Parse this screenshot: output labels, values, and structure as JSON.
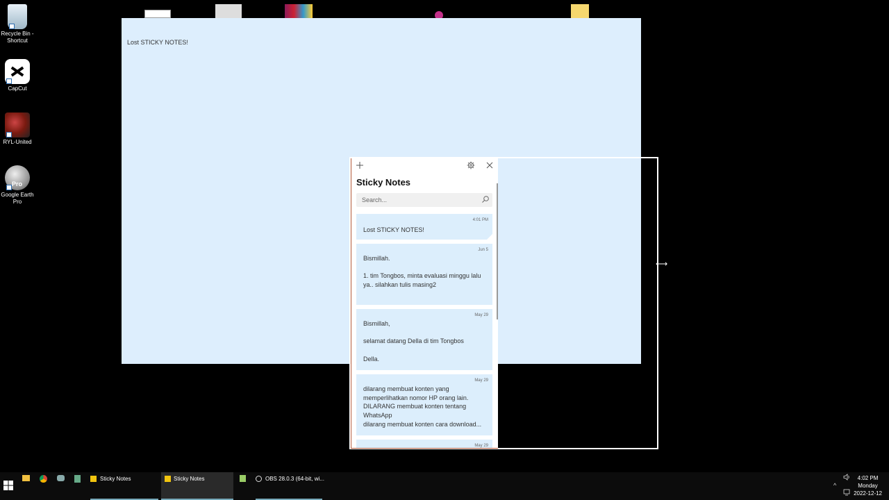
{
  "desktop": {
    "icons": [
      {
        "label": "Recycle Bin - Shortcut"
      },
      {
        "label": "CapCut"
      },
      {
        "label": "RYL-United"
      },
      {
        "label": "Google Earth Pro"
      }
    ],
    "google_earth_badge": "Pro"
  },
  "note_window": {
    "content": "Lost STICKY NOTES!"
  },
  "list_window": {
    "title": "Sticky Notes",
    "search_placeholder": "Search...",
    "notes": [
      {
        "date": "4:01 PM",
        "body": "Lost STICKY NOTES!"
      },
      {
        "date": "Jun 5",
        "body": "Bismillah.\n\n1. tim Tongbos, minta evaluasi minggu lalu ya.. silahkan tulis masing2"
      },
      {
        "date": "May 29",
        "body": "Bismillah,\n\nselamat datang Della di tim Tongbos\n\nDella."
      },
      {
        "date": "May 29",
        "body": "dilarang membuat konten yang memperlihatkan nomor HP orang lain.\nDILARANG membuat konten tentang WhatsApp\ndilarang membuat konten cara download..."
      },
      {
        "date": "May 29",
        "body": ""
      }
    ]
  },
  "taskbar": {
    "items": [
      {
        "label": "Sticky Notes"
      },
      {
        "label": "Sticky Notes"
      },
      {
        "label": "OBS 28.0.3 (64-bit, wi..."
      }
    ],
    "clock": {
      "time": "4:02 PM",
      "day": "Monday",
      "date": "2022-12-12"
    }
  },
  "colors": {
    "note_bg": "#ddeefd",
    "card_bg": "#dceefc",
    "resize_border": "#ffffff",
    "window_edge": "#b35a3a"
  }
}
